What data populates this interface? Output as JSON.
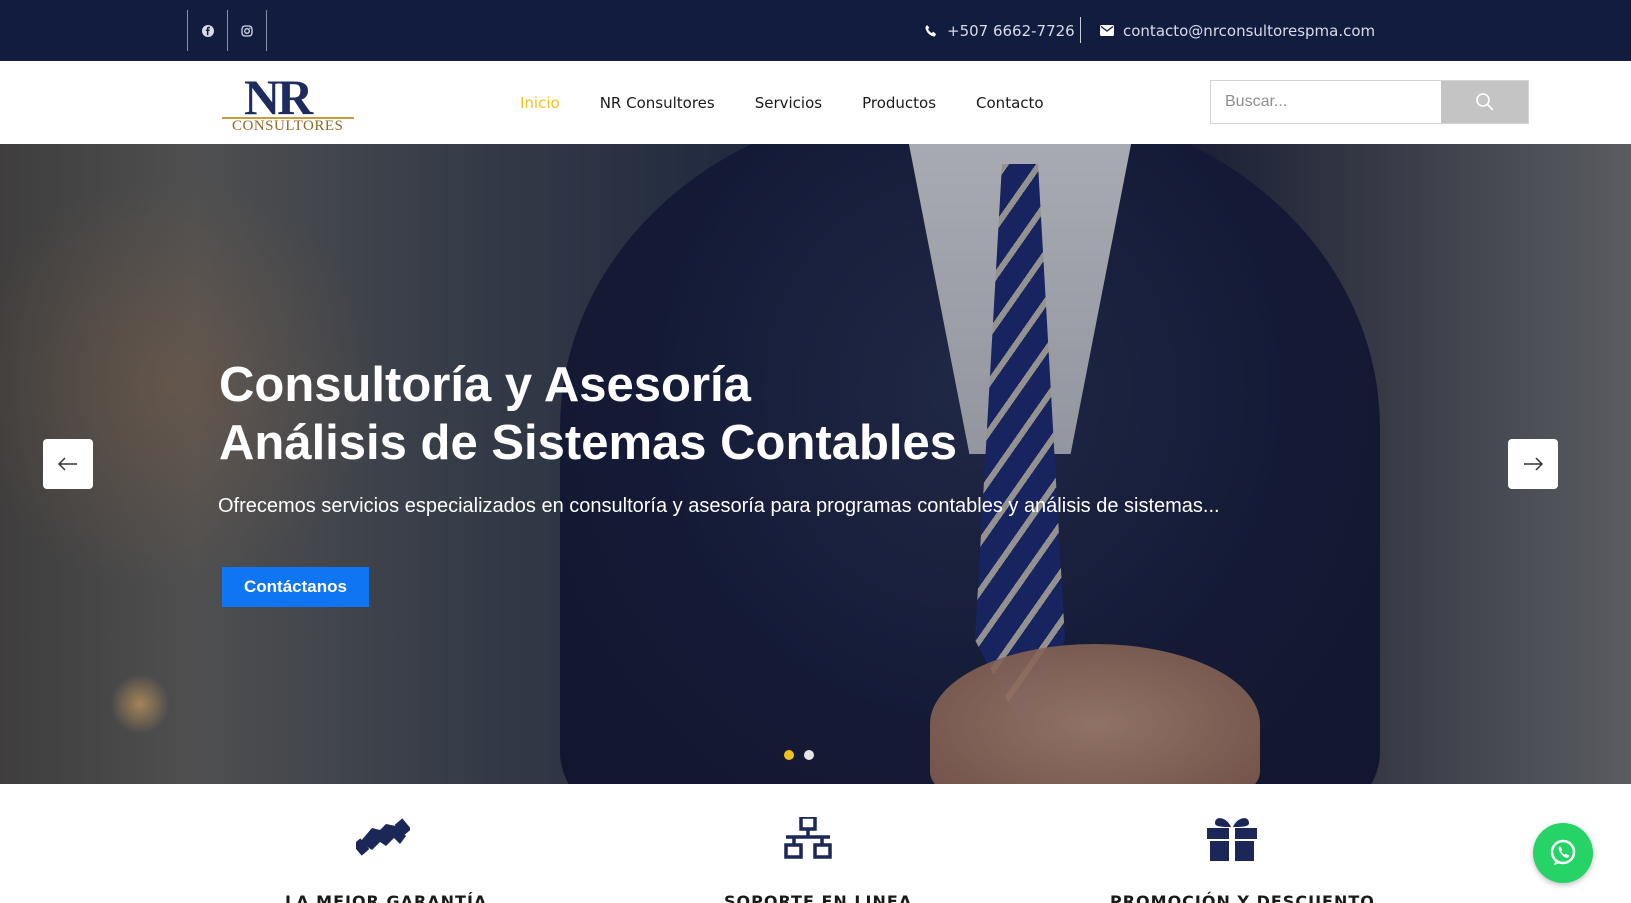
{
  "topbar": {
    "social": [
      {
        "icon": "facebook-icon"
      },
      {
        "icon": "instagram-icon"
      }
    ],
    "phone": "+507 6662-7726",
    "email": "contacto@nrconsultorespma.com"
  },
  "logo": {
    "main": "NR",
    "sub": "CONSULTORES"
  },
  "nav": {
    "items": [
      {
        "label": "Inicio",
        "active": true
      },
      {
        "label": "NR Consultores",
        "active": false
      },
      {
        "label": "Servicios",
        "active": false
      },
      {
        "label": "Productos",
        "active": false
      },
      {
        "label": "Contacto",
        "active": false
      }
    ]
  },
  "search": {
    "placeholder": "Buscar..."
  },
  "hero": {
    "title_line1": "Consultoría y Asesoría",
    "title_line2": "Análisis de Sistemas Contables",
    "subtitle": "Ofrecemos servicios especializados en consultoría y asesoría para programas contables y análisis de sistemas...",
    "button": "Contáctanos",
    "slides": 2,
    "active_slide": 1
  },
  "features": [
    {
      "icon": "handshake-icon",
      "title": "LA MEJOR GARANTÍA"
    },
    {
      "icon": "network-icon",
      "title": "SOPORTE EN LINEA"
    },
    {
      "icon": "gift-icon",
      "title": "PROMOCIÓN Y DESCUENTO"
    }
  ],
  "colors": {
    "topbar": "#111c3f",
    "accent": "#f2c21c",
    "button": "#0f75f2",
    "whatsapp": "#25d366"
  }
}
